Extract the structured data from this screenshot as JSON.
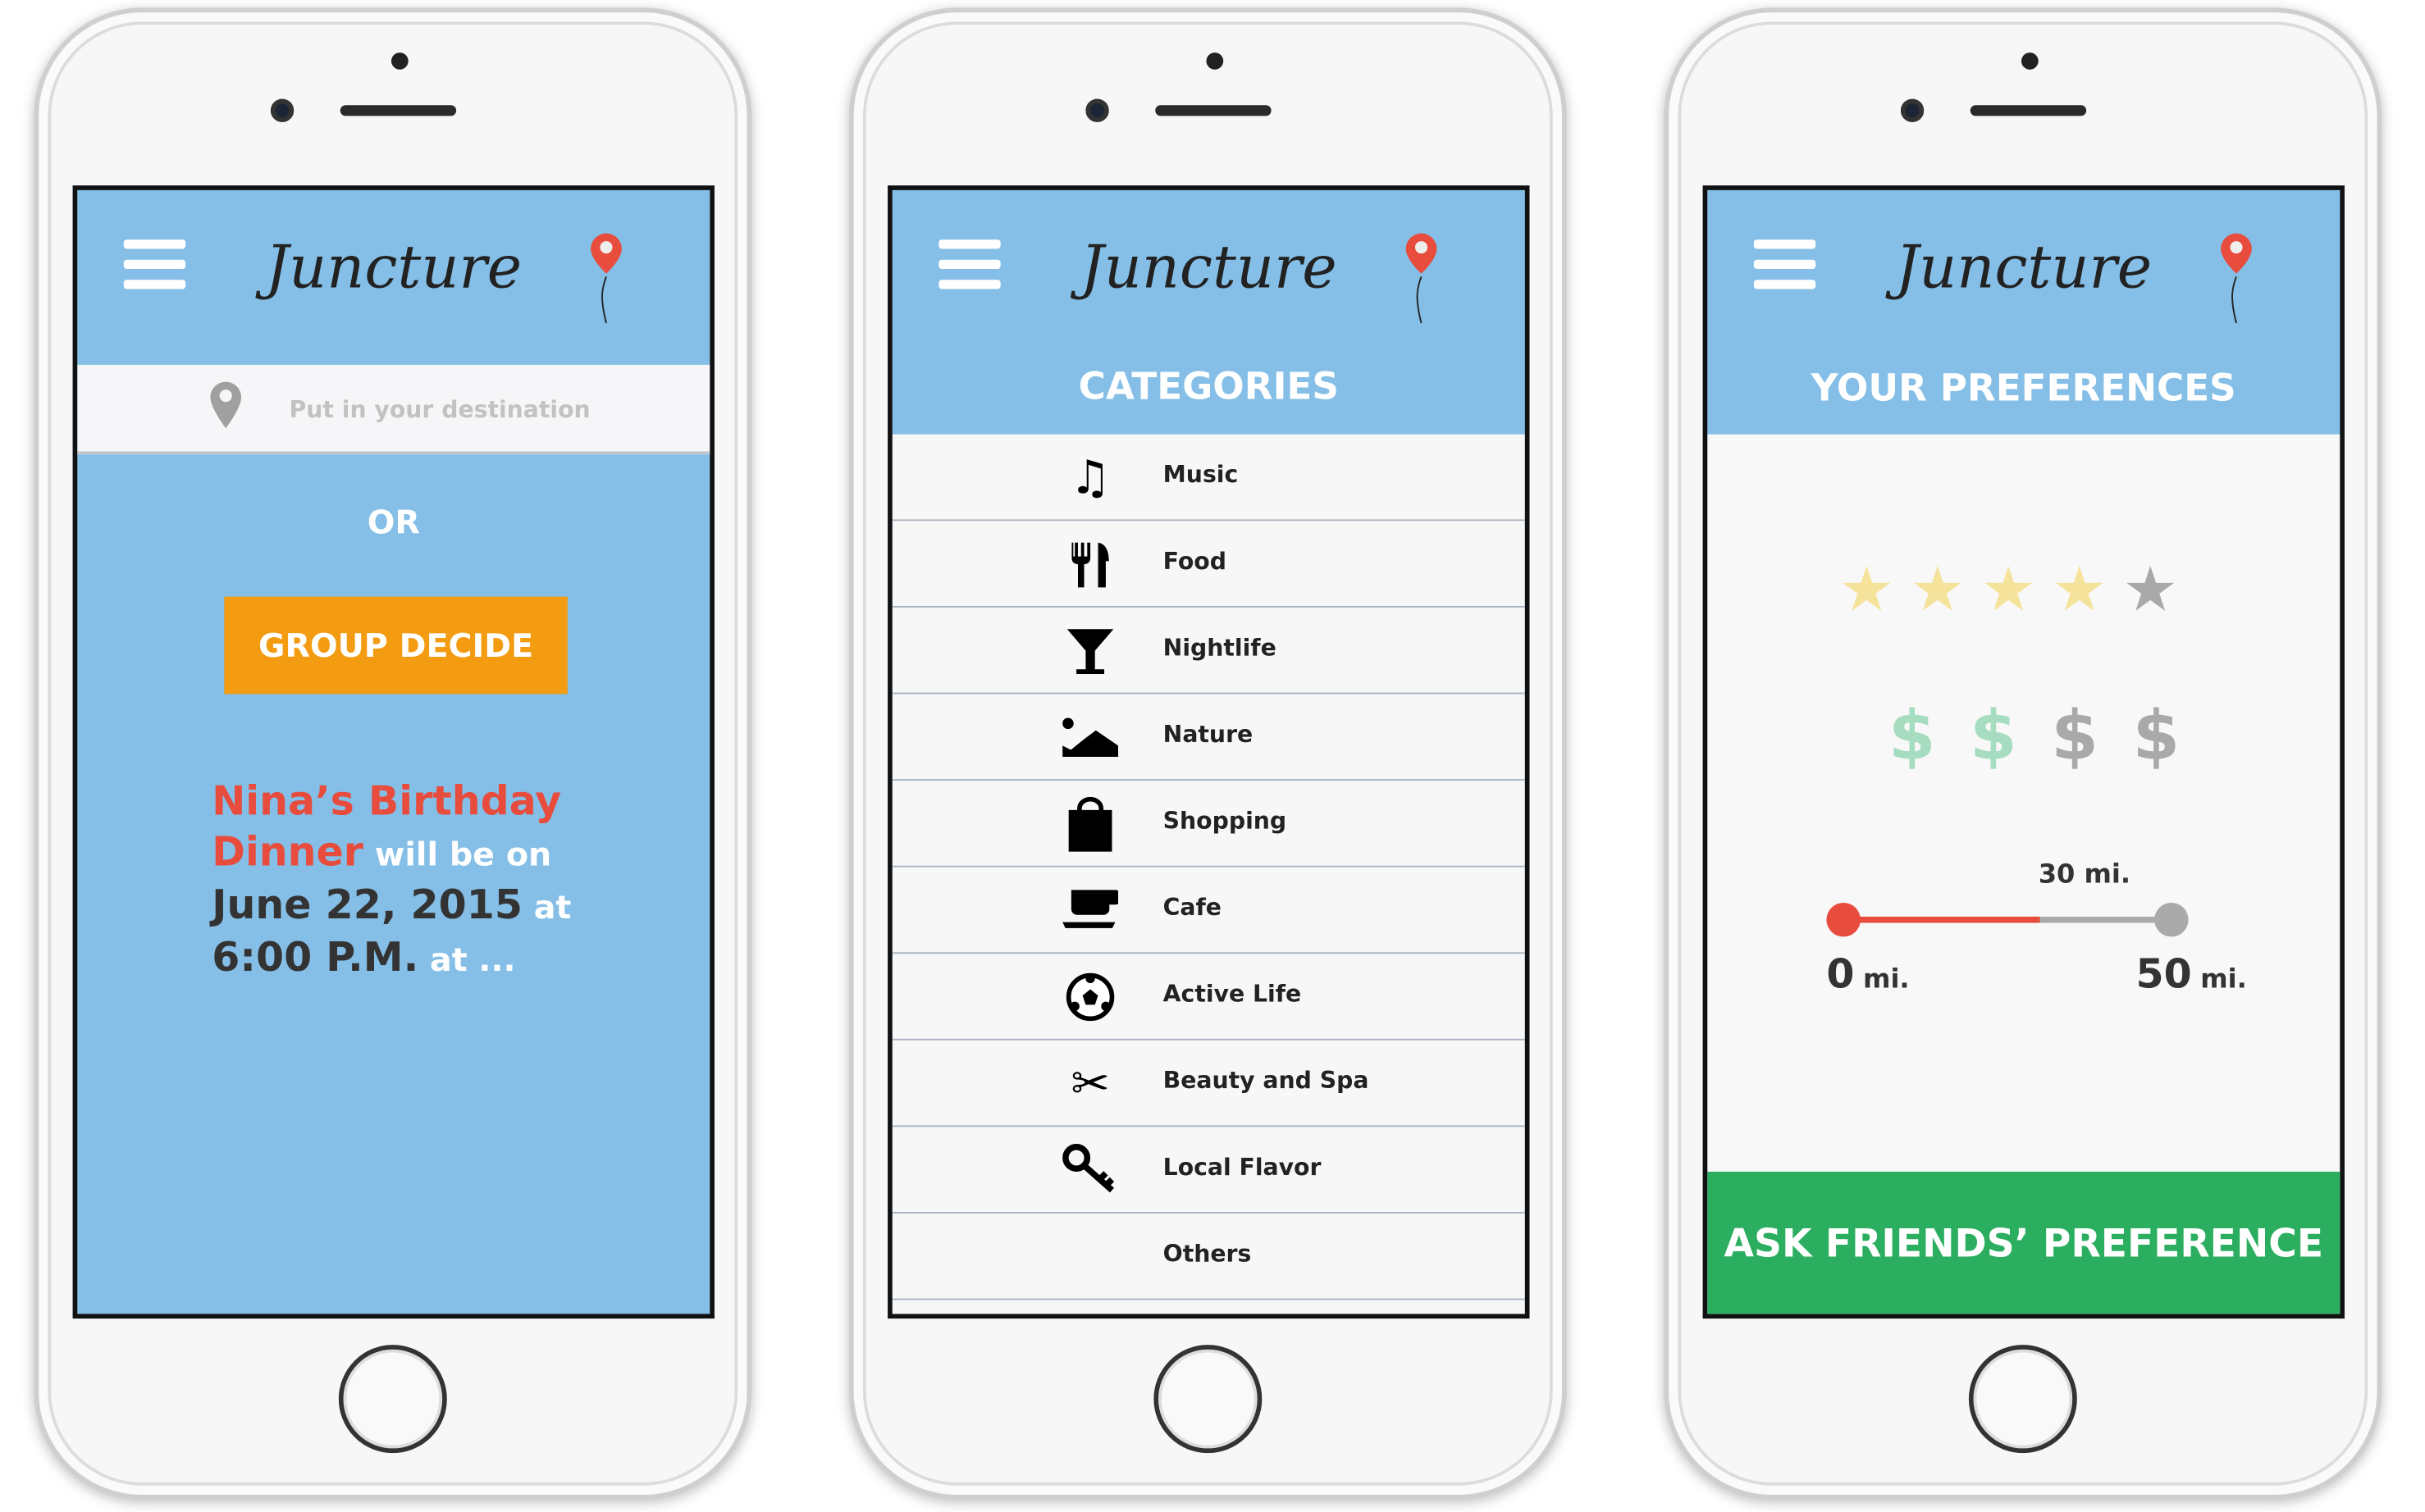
{
  "app_name": "Juncture",
  "colors": {
    "header_blue": "#85bfe7",
    "orange": "#f39c12",
    "red": "#e74c3c",
    "green": "#2bae5f",
    "star_on": "#f5e39c",
    "star_off": "#a9a9a9",
    "dollar_on": "#a6dcbf",
    "dollar_off": "#a9a9a9"
  },
  "screen1": {
    "search_placeholder": "Put in your destination",
    "or_label": "OR",
    "group_decide": "GROUP DECIDE",
    "event": {
      "name_line1": "Nina’s Birthday",
      "name_line2": "Dinner",
      "will_be_on": " will be on",
      "date": "June 22, 2015",
      "at1": " at",
      "time": "6:00 P.M.",
      "at2": "  at ..."
    }
  },
  "screen2": {
    "title": "CATEGORIES",
    "categories": [
      {
        "label": "Music",
        "icon": "music-note-icon"
      },
      {
        "label": "Food",
        "icon": "fork-knife-icon"
      },
      {
        "label": "Nightlife",
        "icon": "cocktail-glass-icon"
      },
      {
        "label": "Nature",
        "icon": "landscape-icon"
      },
      {
        "label": "Shopping",
        "icon": "shopping-bag-icon"
      },
      {
        "label": "Cafe",
        "icon": "coffee-cup-icon"
      },
      {
        "label": "Active Life",
        "icon": "soccer-ball-icon"
      },
      {
        "label": "Beauty and Spa",
        "icon": "scissors-icon"
      },
      {
        "label": "Local Flavor",
        "icon": "key-icon"
      },
      {
        "label": "Others",
        "icon": ""
      }
    ]
  },
  "screen3": {
    "title": "YOUR PREFERENCES",
    "rating": 4,
    "rating_max": 5,
    "price_level": 2,
    "price_max": 4,
    "distance": {
      "value": 30,
      "min": 0,
      "max": 50,
      "value_label": "30 mi.",
      "min_num": "0",
      "max_num": "50",
      "unit": "mi."
    },
    "ask_button": "ASK FRIENDS’ PREFERENCE"
  }
}
